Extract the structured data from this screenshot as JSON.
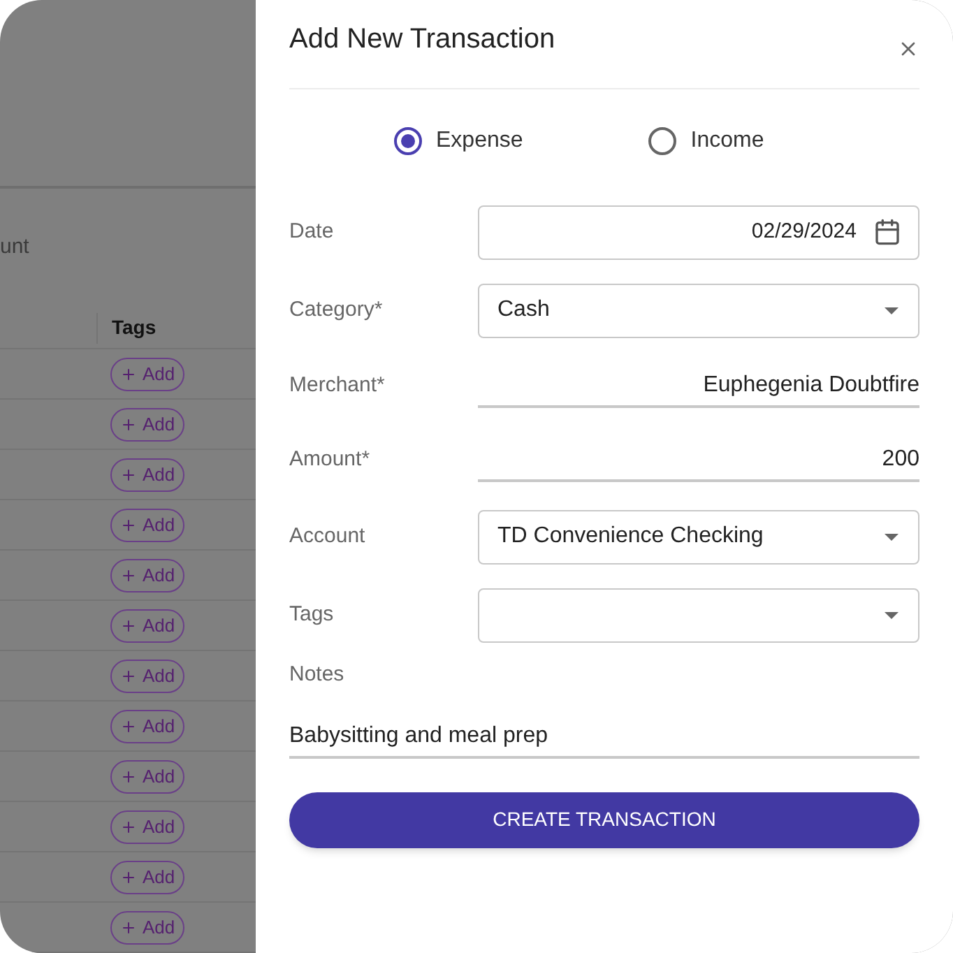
{
  "background": {
    "column_heading_fragment": "unt",
    "table_heading": "Tags",
    "rows": [
      {
        "tag_button": "Add"
      },
      {
        "tag_button": "Add"
      },
      {
        "tag_button": "Add"
      },
      {
        "tag_button": "Add"
      },
      {
        "tag_button": "Add"
      },
      {
        "tag_button": "Add"
      },
      {
        "tag_button": "Add"
      },
      {
        "tag_button": "Add"
      },
      {
        "tag_button": "Add"
      },
      {
        "tag_button": "Add"
      },
      {
        "tag_button": "Add"
      },
      {
        "tag_button": "Add"
      }
    ]
  },
  "dialog": {
    "title": "Add New Transaction",
    "type_options": [
      {
        "label": "Expense",
        "selected": true
      },
      {
        "label": "Income",
        "selected": false
      }
    ],
    "fields": [
      {
        "kind": "date",
        "label": "Date",
        "value": "02/29/2024"
      },
      {
        "kind": "select",
        "label": "Category*",
        "value": "Cash"
      },
      {
        "kind": "text",
        "label": "Merchant*",
        "value": "Euphegenia Doubtfire"
      },
      {
        "kind": "text",
        "label": "Amount*",
        "value": "200"
      },
      {
        "kind": "select",
        "label": "Account",
        "value": "TD Convenience Checking"
      },
      {
        "kind": "select",
        "label": "Tags"
      }
    ],
    "notes": {
      "label": "Notes",
      "value": "Babysitting and meal prep"
    },
    "submit_button": "CREATE TRANSACTION"
  }
}
